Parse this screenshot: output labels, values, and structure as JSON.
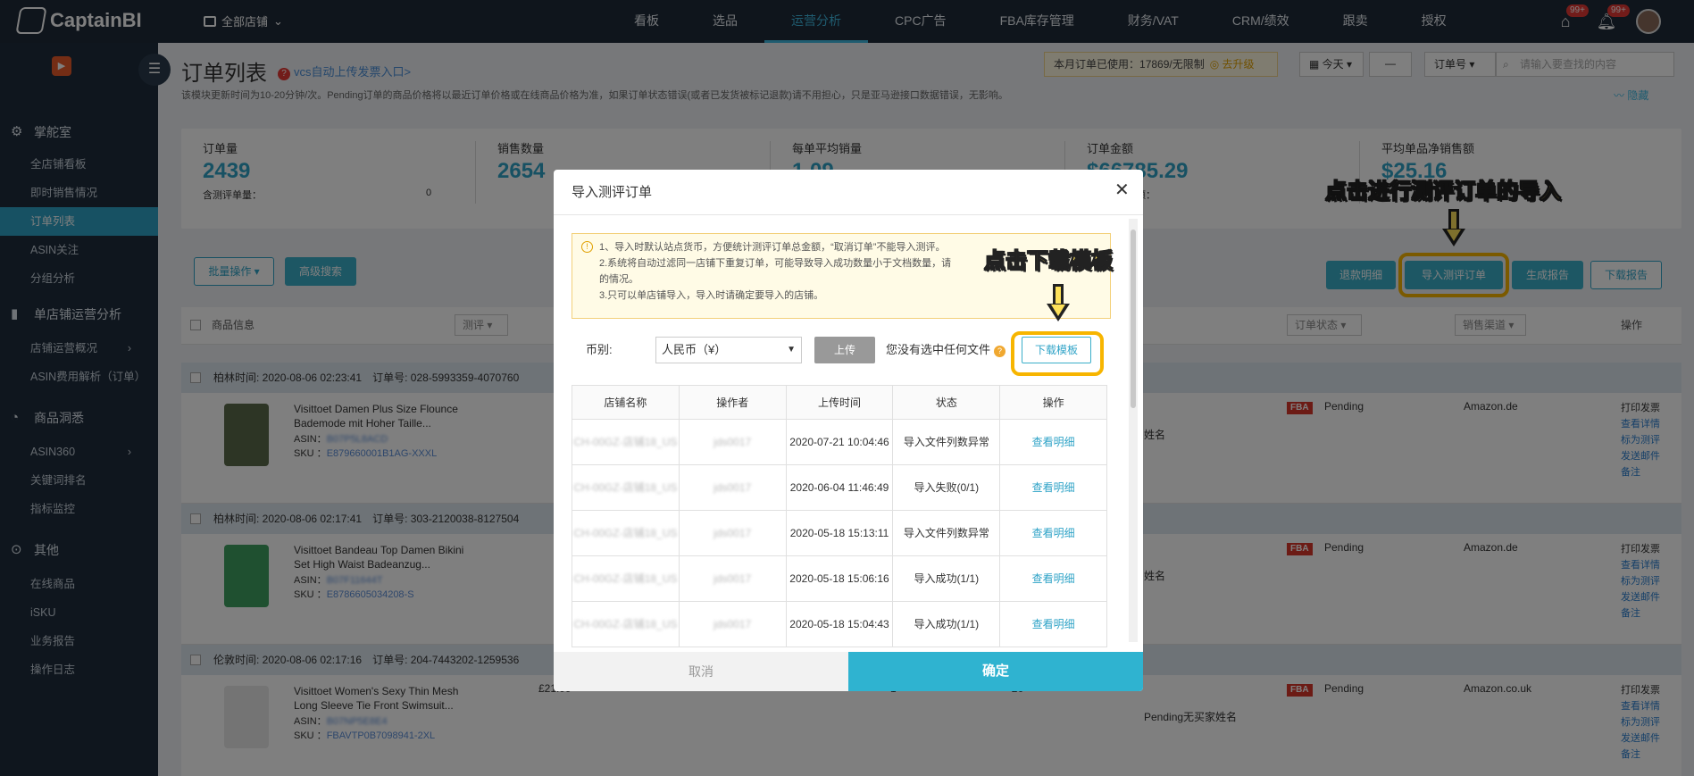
{
  "app": {
    "logo": "CaptainBI",
    "store_selector": "全部店铺",
    "badge1": "99+",
    "badge2": "99+"
  },
  "nav": [
    {
      "label": "看板"
    },
    {
      "label": "选品"
    },
    {
      "label": "运营分析",
      "active": true
    },
    {
      "label": "CPC广告"
    },
    {
      "label": "FBA库存管理"
    },
    {
      "label": "财务/VAT"
    },
    {
      "label": "CRM/绩效"
    },
    {
      "label": "跟卖"
    },
    {
      "label": "授权"
    }
  ],
  "sidebar": {
    "sections": [
      {
        "label": "掌舵室"
      },
      {
        "label": "单店铺运营分析"
      },
      {
        "label": "商品洞悉"
      },
      {
        "label": "其他"
      }
    ],
    "items": [
      "全店铺看板",
      "即时销售情况",
      "订单列表",
      "ASIN关注",
      "分组分析",
      "店铺运营概况",
      "ASIN费用解析（订单）",
      "ASIN360",
      "关键词排名",
      "指标监控",
      "在线商品",
      "iSKU",
      "业务报告",
      "操作日志"
    ]
  },
  "header": {
    "title": "订单列表",
    "vcs_link": "vcs自动上传发票入口>",
    "notice": "该模块更新时间为10-20分钟/次。Pending订单的商品价格将以最近订单价格或在线商品价格为准，如果订单状态错误(或者已发货被标记退款)请不用担心，只是亚马逊接口数据错误，无影响。",
    "hide": "隐藏",
    "usage_label": "本月订单已使用：",
    "usage_value": "17869/无限制",
    "upgrade": "去升级",
    "date": "今天",
    "dash": "—",
    "order_no": "订单号",
    "search_placeholder": "请输入要查找的内容"
  },
  "stats": [
    {
      "label": "订单量",
      "value": "2439",
      "sub": "含测评单量：",
      "subv": "0"
    },
    {
      "label": "销售数量",
      "value": "2654",
      "sub": "",
      "subv": ""
    },
    {
      "label": "每单平均销量",
      "value": "1.09",
      "sub": "",
      "subv": ""
    },
    {
      "label": "订单金额",
      "value": "$66785.29",
      "sub": "测评订单金额：",
      "subv": ""
    },
    {
      "label": "平均单品净销售额",
      "value": "$25.16",
      "sub": "",
      "subv": ""
    }
  ],
  "actions": {
    "batch": "批量操作",
    "advanced": "高级搜索",
    "refund": "退款明细",
    "import": "导入测评订单",
    "report": "生成报告",
    "download_report": "下载报告"
  },
  "table_header": {
    "product": "商品信息",
    "review": "测评",
    "order_status": "订单状态",
    "channel": "销售渠道",
    "op": "操作"
  },
  "groups": [
    {
      "time": "柏林时间: 2020-08-06 02:23:41",
      "order": "订单号: 028-5993359-4070760"
    },
    {
      "time": "柏林时间: 2020-08-06 02:17:41",
      "order": "订单号: 303-2120038-8127504"
    },
    {
      "time": "伦敦时间: 2020-08-06 02:17:16",
      "order": "订单号: 204-7443202-1259536"
    }
  ],
  "rows": [
    {
      "title": "Visittoet Damen Plus Size Flounce Bademode mit Hoher Taille...",
      "asin_label": "ASIN：",
      "asin": "B07P5L8ACD",
      "sku_label": "SKU ：",
      "sku": "E879660001B1AG-XXXL",
      "name": "姓名",
      "status": "Pending",
      "market": "Amazon.de",
      "price": "",
      "qty": "",
      "amt": ""
    },
    {
      "title": "Visittoet Bandeau Top Damen Bikini Set High Waist Badeanzug...",
      "asin_label": "ASIN：",
      "asin": "B07F11644T",
      "sku_label": "SKU ：",
      "sku": "E8786605034208-S",
      "name": "姓名",
      "status": "Pending",
      "market": "Amazon.de",
      "price": "",
      "qty": "",
      "amt": ""
    },
    {
      "title": "Visittoet Women's Sexy Thin Mesh Long Sleeve Tie Front Swimsuit...",
      "asin_label": "ASIN：",
      "asin": "B07NP5E8E4",
      "sku_label": "SKU ：",
      "sku": "FBAVTP0B7098941-2XL",
      "name": "Pending无买家姓名",
      "status": "Pending",
      "market": "Amazon.co.uk",
      "price": "£21.99",
      "qty": "1",
      "amt": "£0"
    }
  ],
  "row_ops": [
    "打印发票",
    "查看详情",
    "标为测评",
    "发送邮件",
    "备注"
  ],
  "modal": {
    "title": "导入测评订单",
    "tips": [
      "1、导入时默认站点货币，方便统计测评订单总金额，“取消订单”不能导入测评。",
      "2.系统将自动过滤同一店铺下重复订单，可能导致导入成功数量小于文档数量，请",
      "的情况。",
      "3.只可以单店铺导入，导入时请确定要导入的店铺。"
    ],
    "currency_label": "币别:",
    "currency": "人民币（¥）",
    "upload": "上传",
    "nofile": "您没有选中任何文件",
    "download_template": "下载模板",
    "columns": [
      "店铺名称",
      "操作者",
      "上传时间",
      "状态",
      "操作"
    ],
    "rows": [
      {
        "store": "CH-00GZ-店铺18_US",
        "op": "jds0017",
        "time": "2020-07-21 10:04:46",
        "status": "导入文件列数异常",
        "action": "查看明细"
      },
      {
        "store": "CH-00GZ-店铺18_US",
        "op": "jds0017",
        "time": "2020-06-04 11:46:49",
        "status": "导入失败(0/1)",
        "action": "查看明细"
      },
      {
        "store": "CH-00GZ-店铺18_US",
        "op": "jds0017",
        "time": "2020-05-18 15:13:11",
        "status": "导入文件列数异常",
        "action": "查看明细"
      },
      {
        "store": "CH-00GZ-店铺18_US",
        "op": "jds0017",
        "time": "2020-05-18 15:06:16",
        "status": "导入成功(1/1)",
        "action": "查看明细"
      },
      {
        "store": "CH-00GZ-店铺18_US",
        "op": "jds0017",
        "time": "2020-05-18 15:04:43",
        "status": "导入成功(1/1)",
        "action": "查看明细"
      }
    ],
    "cancel": "取消",
    "ok": "确定"
  },
  "annotations": {
    "import_hint": "点击进行测评订单的导入",
    "download_hint": "点击下载模板"
  }
}
